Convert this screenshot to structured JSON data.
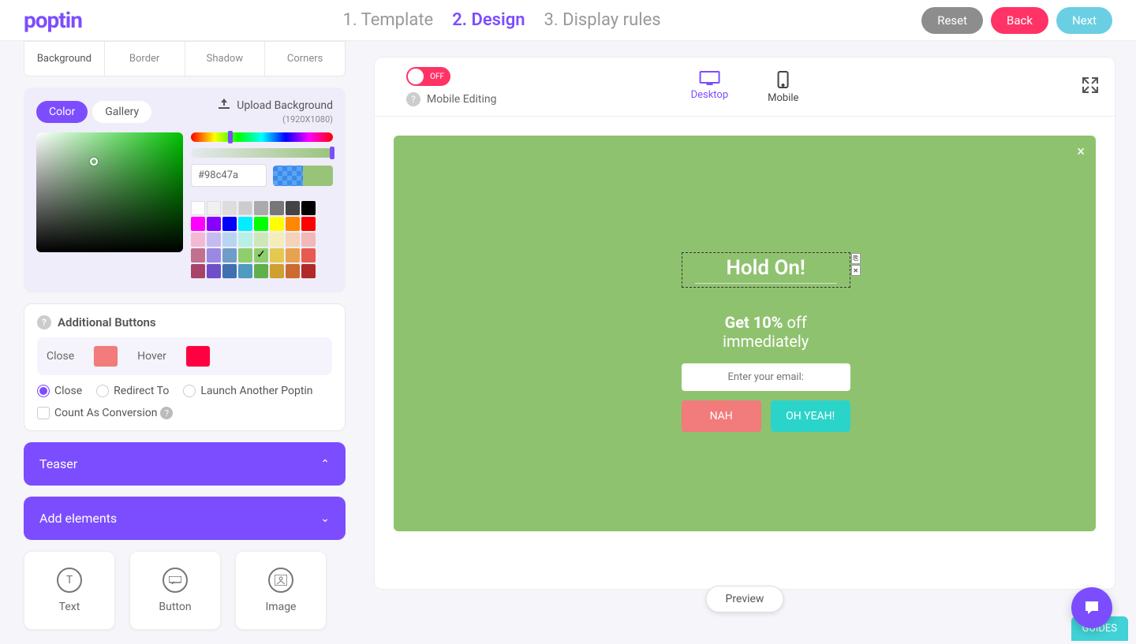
{
  "header": {
    "logo": "poptin",
    "steps": [
      {
        "label": "1. Template",
        "active": false
      },
      {
        "label": "2. Design",
        "active": true
      },
      {
        "label": "3. Display rules",
        "active": false
      }
    ],
    "reset": "Reset",
    "back": "Back",
    "next": "Next"
  },
  "prop_tabs": {
    "background": "Background",
    "border": "Border",
    "shadow": "Shadow",
    "corners": "Corners"
  },
  "color_panel": {
    "color_pill": "Color",
    "gallery_pill": "Gallery",
    "upload_label": "Upload Background",
    "upload_size": "(1920X1080)",
    "hex_value": "#98c47a",
    "swatches_row1": [
      "#ffffff",
      "#f0f0f0",
      "#dddddd",
      "#cccccc",
      "#aaaaaa",
      "#777777",
      "#444444",
      "#000000"
    ],
    "swatches_row2": [
      "#ff00ff",
      "#8800ff",
      "#0000ff",
      "#00eeff",
      "#00ff00",
      "#ffff00",
      "#ff8800",
      "#ff0000"
    ],
    "swatches_row3": [
      "#f2b8d4",
      "#c6bbf0",
      "#b8d4f2",
      "#b8f0e5",
      "#cce8b8",
      "#f5edb8",
      "#f5d2b8",
      "#f2b8b8"
    ],
    "swatches_row4": [
      "#c2708e",
      "#9a88e5",
      "#6f9cc9",
      "#8fce6d",
      "#8fce6d",
      "#e5c94f",
      "#e8a24f",
      "#e85a4f"
    ],
    "swatches_row5": [
      "#a8446a",
      "#6f4fc9",
      "#3f70b0",
      "#4f9abf",
      "#5fb04a",
      "#cf9f30",
      "#cc6a30",
      "#b02a2a"
    ],
    "selected_swatch_index": 28
  },
  "additional_buttons": {
    "title": "Additional Buttons",
    "close_label": "Close",
    "close_color": "#f27b7b",
    "hover_label": "Hover",
    "hover_color": "#ff0040",
    "radio_close": "Close",
    "radio_redirect": "Redirect To",
    "radio_launch": "Launch Another Poptin",
    "check_count": "Count As Conversion"
  },
  "accordions": {
    "teaser": "Teaser",
    "add_elements": "Add elements"
  },
  "elements": {
    "text": "Text",
    "button": "Button",
    "image": "Image"
  },
  "canvas": {
    "toggle_label": "OFF",
    "mobile_editing": "Mobile Editing",
    "desktop": "Desktop",
    "mobile": "Mobile",
    "popup": {
      "title": "Hold On!",
      "subtitle_bold": "Get 10%",
      "subtitle_rest": " off immediately",
      "input_placeholder": "Enter your email:",
      "btn_nah": "NAH",
      "btn_yeah": "OH YEAH!"
    },
    "preview": "Preview",
    "guides": "GUIDES"
  }
}
